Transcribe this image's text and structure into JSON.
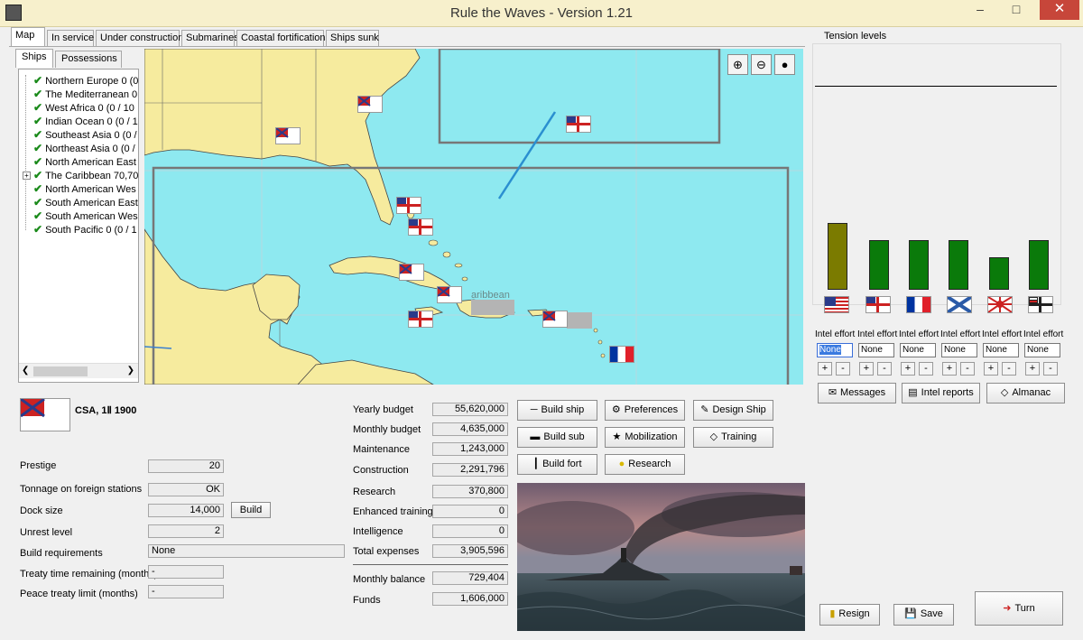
{
  "window": {
    "title": "Rule the Waves - Version 1.21"
  },
  "tabs": [
    "Map",
    "In service",
    "Under construction",
    "Submarines",
    "Coastal fortifications",
    "Ships sunk"
  ],
  "subtabs": [
    "Ships",
    "Possessions"
  ],
  "tree": [
    "Northern Europe 0 (0",
    "The Mediterranean 0",
    "West Africa 0 (0 / 10",
    "Indian Ocean 0 (0 / 1",
    "Southeast Asia 0 (0 /",
    "Northeast Asia 0 (0 /",
    "North American East",
    "The Caribbean 70,70",
    "North American Wes",
    "South American East",
    "South American Wes",
    "South Pacific 0 (0 / 1"
  ],
  "map": {
    "label": "aribbean",
    "zoom_in_icon": "zoom-in-icon",
    "zoom_out_icon": "zoom-out-icon",
    "drop_icon": "drop-icon"
  },
  "nation": {
    "name": "CSA, 1Ⅱ 1900"
  },
  "stats": {
    "prestige_label": "Prestige",
    "prestige": "20",
    "tonnage_label": "Tonnage on foreign stations",
    "tonnage": "OK",
    "dock_label": "Dock size",
    "dock": "14,000",
    "build_label": "Build",
    "unrest_label": "Unrest level",
    "unrest": "2",
    "req_label": "Build requirements",
    "req": "None",
    "treaty_label": "Treaty time remaining (months)",
    "treaty": "-",
    "peace_label": "Peace treaty limit (months)",
    "peace": "-"
  },
  "budget": {
    "yearly_label": "Yearly budget",
    "yearly": "55,620,000",
    "monthly_label": "Monthly budget",
    "monthly": "4,635,000",
    "maint_label": "Maintenance",
    "maint": "1,243,000",
    "constr_label": "Construction",
    "constr": "2,291,796",
    "research_label": "Research",
    "research": "370,800",
    "training_label": "Enhanced training",
    "training": "0",
    "intel_label": "Intelligence",
    "intel": "0",
    "total_label": "Total expenses",
    "total": "3,905,596",
    "balance_label": "Monthly balance",
    "balance": "729,404",
    "funds_label": "Funds",
    "funds": "1,606,000"
  },
  "actions": {
    "build_ship": "Build ship",
    "preferences": "Preferences",
    "design_ship": "Design Ship",
    "build_sub": "Build sub",
    "mobilization": "Mobilization",
    "training": "Training",
    "build_fort": "Build fort",
    "research": "Research"
  },
  "tension": {
    "title": "Tension levels",
    "levels": [
      0.62,
      0.46,
      0.46,
      0.46,
      0.3,
      0.46
    ],
    "bar_colors": [
      "#7b7b00",
      "#0a7a0a",
      "#0a7a0a",
      "#0a7a0a",
      "#0a7a0a",
      "#0a7a0a"
    ],
    "nations": [
      "usa-flag",
      "uk-flag",
      "france-flag",
      "russia-flag",
      "japan-flag",
      "germany-flag"
    ]
  },
  "intel": {
    "label": "Intel effort",
    "values": [
      "None",
      "None",
      "None",
      "None",
      "None",
      "None"
    ],
    "plus": "+",
    "minus": "-"
  },
  "panel": {
    "messages": "Messages",
    "intel_reports": "Intel reports",
    "almanac": "Almanac",
    "resign": "Resign",
    "save": "Save",
    "turn": "Turn"
  }
}
